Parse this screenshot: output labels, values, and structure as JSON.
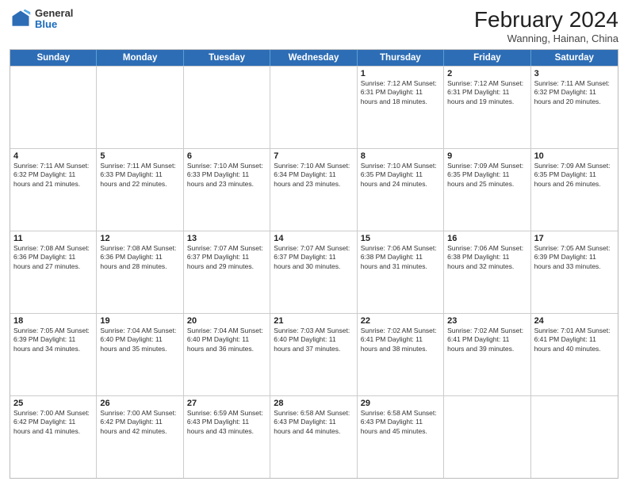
{
  "header": {
    "logo": {
      "general": "General",
      "blue": "Blue"
    },
    "title": "February 2024",
    "subtitle": "Wanning, Hainan, China"
  },
  "weekdays": [
    "Sunday",
    "Monday",
    "Tuesday",
    "Wednesday",
    "Thursday",
    "Friday",
    "Saturday"
  ],
  "weeks": [
    [
      {
        "date": "",
        "info": ""
      },
      {
        "date": "",
        "info": ""
      },
      {
        "date": "",
        "info": ""
      },
      {
        "date": "",
        "info": ""
      },
      {
        "date": "1",
        "info": "Sunrise: 7:12 AM\nSunset: 6:31 PM\nDaylight: 11 hours and 18 minutes."
      },
      {
        "date": "2",
        "info": "Sunrise: 7:12 AM\nSunset: 6:31 PM\nDaylight: 11 hours and 19 minutes."
      },
      {
        "date": "3",
        "info": "Sunrise: 7:11 AM\nSunset: 6:32 PM\nDaylight: 11 hours and 20 minutes."
      }
    ],
    [
      {
        "date": "4",
        "info": "Sunrise: 7:11 AM\nSunset: 6:32 PM\nDaylight: 11 hours and 21 minutes."
      },
      {
        "date": "5",
        "info": "Sunrise: 7:11 AM\nSunset: 6:33 PM\nDaylight: 11 hours and 22 minutes."
      },
      {
        "date": "6",
        "info": "Sunrise: 7:10 AM\nSunset: 6:33 PM\nDaylight: 11 hours and 23 minutes."
      },
      {
        "date": "7",
        "info": "Sunrise: 7:10 AM\nSunset: 6:34 PM\nDaylight: 11 hours and 23 minutes."
      },
      {
        "date": "8",
        "info": "Sunrise: 7:10 AM\nSunset: 6:35 PM\nDaylight: 11 hours and 24 minutes."
      },
      {
        "date": "9",
        "info": "Sunrise: 7:09 AM\nSunset: 6:35 PM\nDaylight: 11 hours and 25 minutes."
      },
      {
        "date": "10",
        "info": "Sunrise: 7:09 AM\nSunset: 6:35 PM\nDaylight: 11 hours and 26 minutes."
      }
    ],
    [
      {
        "date": "11",
        "info": "Sunrise: 7:08 AM\nSunset: 6:36 PM\nDaylight: 11 hours and 27 minutes."
      },
      {
        "date": "12",
        "info": "Sunrise: 7:08 AM\nSunset: 6:36 PM\nDaylight: 11 hours and 28 minutes."
      },
      {
        "date": "13",
        "info": "Sunrise: 7:07 AM\nSunset: 6:37 PM\nDaylight: 11 hours and 29 minutes."
      },
      {
        "date": "14",
        "info": "Sunrise: 7:07 AM\nSunset: 6:37 PM\nDaylight: 11 hours and 30 minutes."
      },
      {
        "date": "15",
        "info": "Sunrise: 7:06 AM\nSunset: 6:38 PM\nDaylight: 11 hours and 31 minutes."
      },
      {
        "date": "16",
        "info": "Sunrise: 7:06 AM\nSunset: 6:38 PM\nDaylight: 11 hours and 32 minutes."
      },
      {
        "date": "17",
        "info": "Sunrise: 7:05 AM\nSunset: 6:39 PM\nDaylight: 11 hours and 33 minutes."
      }
    ],
    [
      {
        "date": "18",
        "info": "Sunrise: 7:05 AM\nSunset: 6:39 PM\nDaylight: 11 hours and 34 minutes."
      },
      {
        "date": "19",
        "info": "Sunrise: 7:04 AM\nSunset: 6:40 PM\nDaylight: 11 hours and 35 minutes."
      },
      {
        "date": "20",
        "info": "Sunrise: 7:04 AM\nSunset: 6:40 PM\nDaylight: 11 hours and 36 minutes."
      },
      {
        "date": "21",
        "info": "Sunrise: 7:03 AM\nSunset: 6:40 PM\nDaylight: 11 hours and 37 minutes."
      },
      {
        "date": "22",
        "info": "Sunrise: 7:02 AM\nSunset: 6:41 PM\nDaylight: 11 hours and 38 minutes."
      },
      {
        "date": "23",
        "info": "Sunrise: 7:02 AM\nSunset: 6:41 PM\nDaylight: 11 hours and 39 minutes."
      },
      {
        "date": "24",
        "info": "Sunrise: 7:01 AM\nSunset: 6:41 PM\nDaylight: 11 hours and 40 minutes."
      }
    ],
    [
      {
        "date": "25",
        "info": "Sunrise: 7:00 AM\nSunset: 6:42 PM\nDaylight: 11 hours and 41 minutes."
      },
      {
        "date": "26",
        "info": "Sunrise: 7:00 AM\nSunset: 6:42 PM\nDaylight: 11 hours and 42 minutes."
      },
      {
        "date": "27",
        "info": "Sunrise: 6:59 AM\nSunset: 6:43 PM\nDaylight: 11 hours and 43 minutes."
      },
      {
        "date": "28",
        "info": "Sunrise: 6:58 AM\nSunset: 6:43 PM\nDaylight: 11 hours and 44 minutes."
      },
      {
        "date": "29",
        "info": "Sunrise: 6:58 AM\nSunset: 6:43 PM\nDaylight: 11 hours and 45 minutes."
      },
      {
        "date": "",
        "info": ""
      },
      {
        "date": "",
        "info": ""
      }
    ]
  ]
}
